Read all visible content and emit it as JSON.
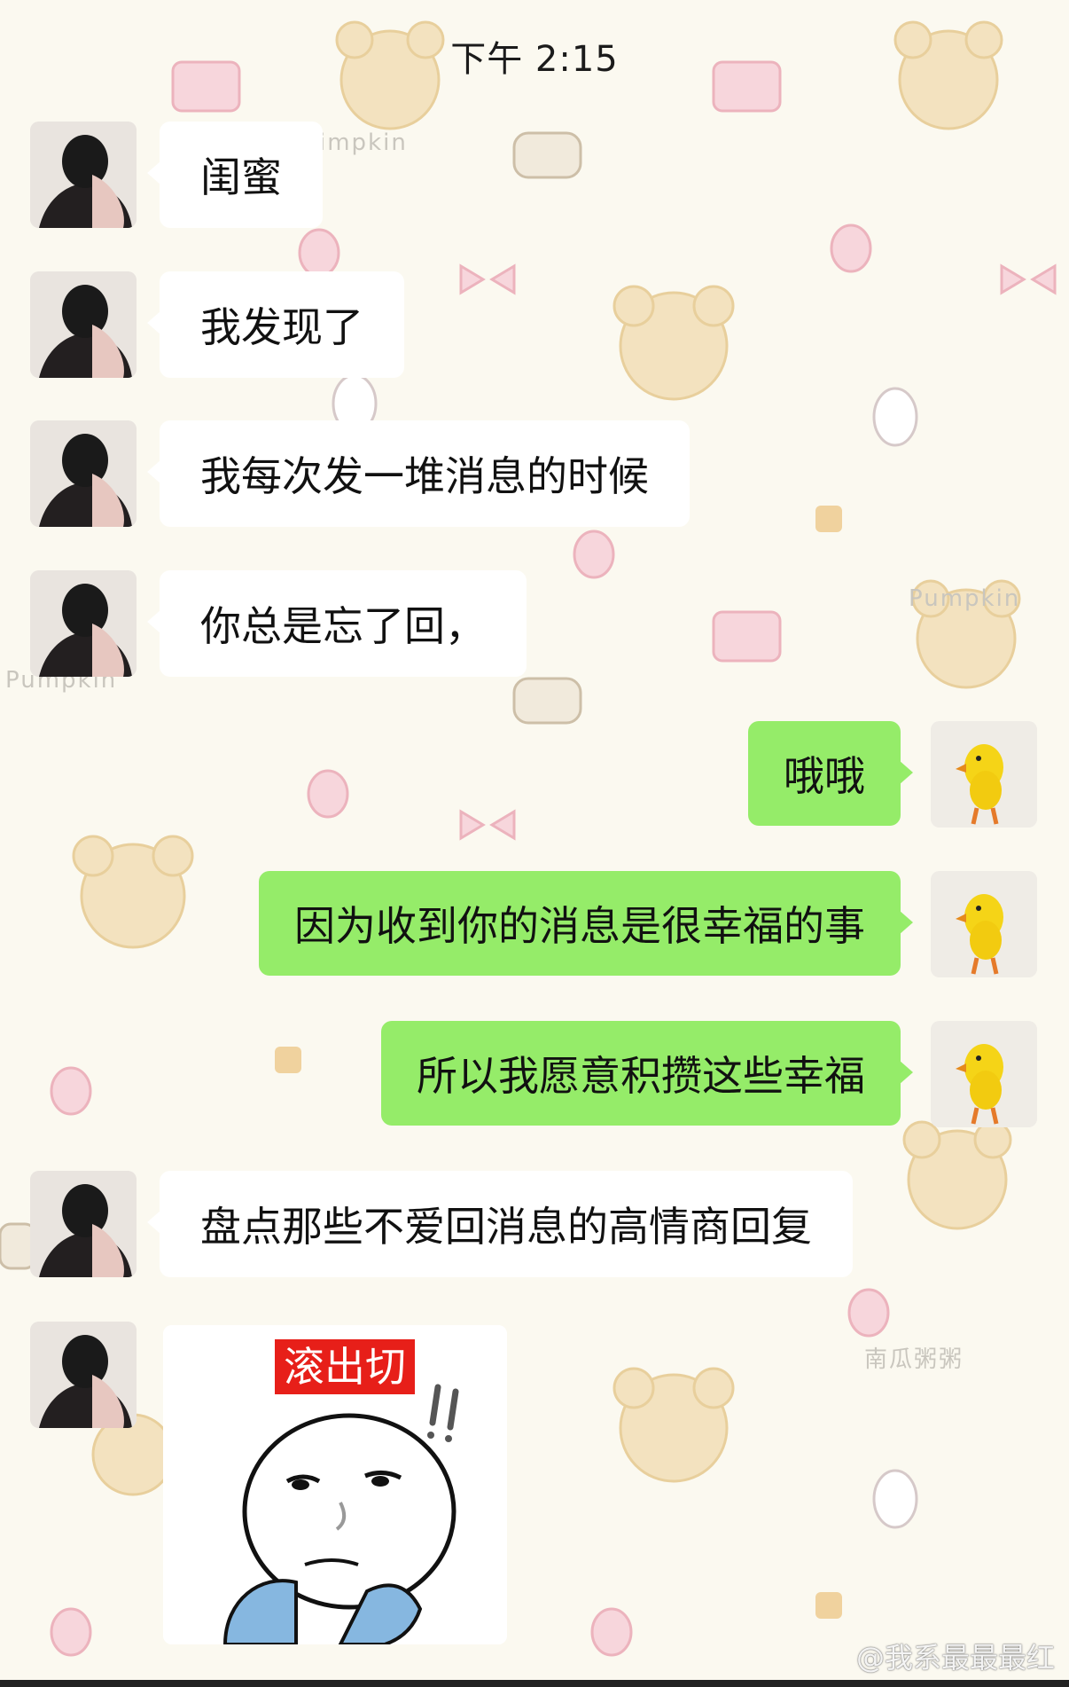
{
  "status": {
    "time": "下午 2:15"
  },
  "messages": [
    {
      "side": "left",
      "text": "闺蜜"
    },
    {
      "side": "left",
      "text": "我发现了"
    },
    {
      "side": "left",
      "text": "我每次发一堆消息的时候"
    },
    {
      "side": "left",
      "text": "你总是忘了回，"
    },
    {
      "side": "right",
      "text": "哦哦"
    },
    {
      "side": "right",
      "text": "因为收到你的消息是很幸福的事"
    },
    {
      "side": "right",
      "text": "所以我愿意积攒这些幸福"
    },
    {
      "side": "left",
      "text": "盘点那些不爱回消息的高情商回复"
    }
  ],
  "sticker": {
    "label": "滚出切"
  },
  "background": {
    "marks": [
      "impkin",
      "Pumpkin",
      "Pumpkin",
      "南瓜粥粥"
    ]
  },
  "watermark": "@我系最最最红",
  "colors": {
    "self_bubble": "#95ec69",
    "other_bubble": "#ffffff",
    "background": "#fbf9f0"
  }
}
